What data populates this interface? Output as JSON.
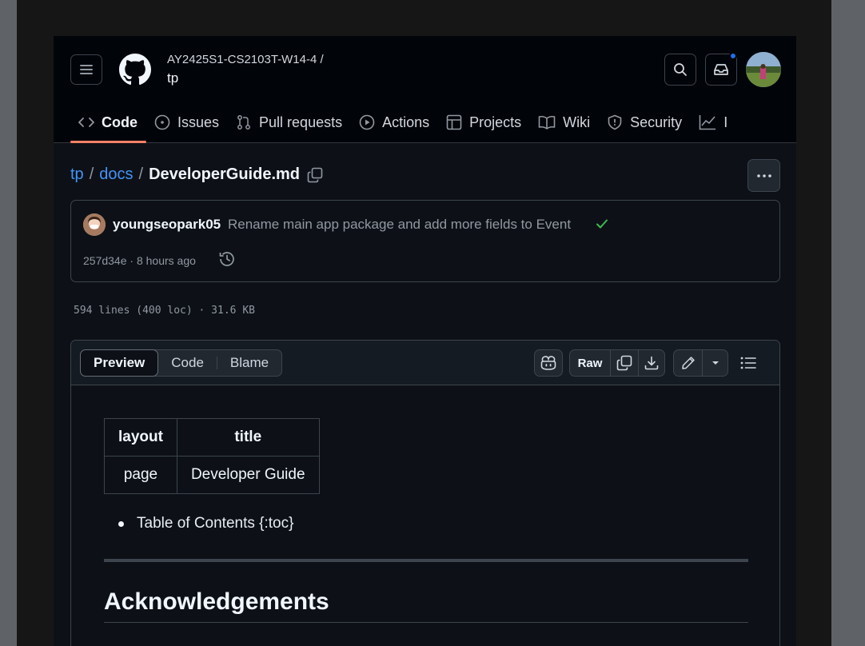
{
  "header": {
    "owner": "AY2425S1-CS2103T-W14-4 /",
    "repo": "tp",
    "tabs": [
      {
        "label": "Code",
        "icon": "code-icon",
        "active": true
      },
      {
        "label": "Issues",
        "icon": "issue-icon",
        "active": false
      },
      {
        "label": "Pull requests",
        "icon": "pull-request-icon",
        "active": false
      },
      {
        "label": "Actions",
        "icon": "play-icon",
        "active": false
      },
      {
        "label": "Projects",
        "icon": "table-icon",
        "active": false
      },
      {
        "label": "Wiki",
        "icon": "book-icon",
        "active": false
      },
      {
        "label": "Security",
        "icon": "shield-icon",
        "active": false
      },
      {
        "label": "I",
        "icon": "graph-icon",
        "active": false
      }
    ]
  },
  "breadcrumb": {
    "root": "tp",
    "sep1": "/",
    "folder": "docs",
    "sep2": "/",
    "file": "DeveloperGuide.md"
  },
  "commit": {
    "author": "youngseopark05",
    "message": "Rename main app package and add more fields to Event",
    "meta": "257d34e · 8 hours ago"
  },
  "file_info": "594 lines (400 loc) · 31.6 KB",
  "viewer": {
    "modes": [
      "Preview",
      "Code",
      "Blame"
    ],
    "selected_mode": "Preview",
    "raw_label": "Raw"
  },
  "content": {
    "table": {
      "headers": [
        "layout",
        "title"
      ],
      "rows": [
        [
          "page",
          "Developer Guide"
        ]
      ]
    },
    "toc_item": "Table of Contents {:toc}",
    "heading": "Acknowledgements"
  },
  "colors": {
    "accent_underline": "#f78166",
    "link": "#4493f8",
    "success": "#3fb950",
    "notification": "#1f6feb"
  }
}
